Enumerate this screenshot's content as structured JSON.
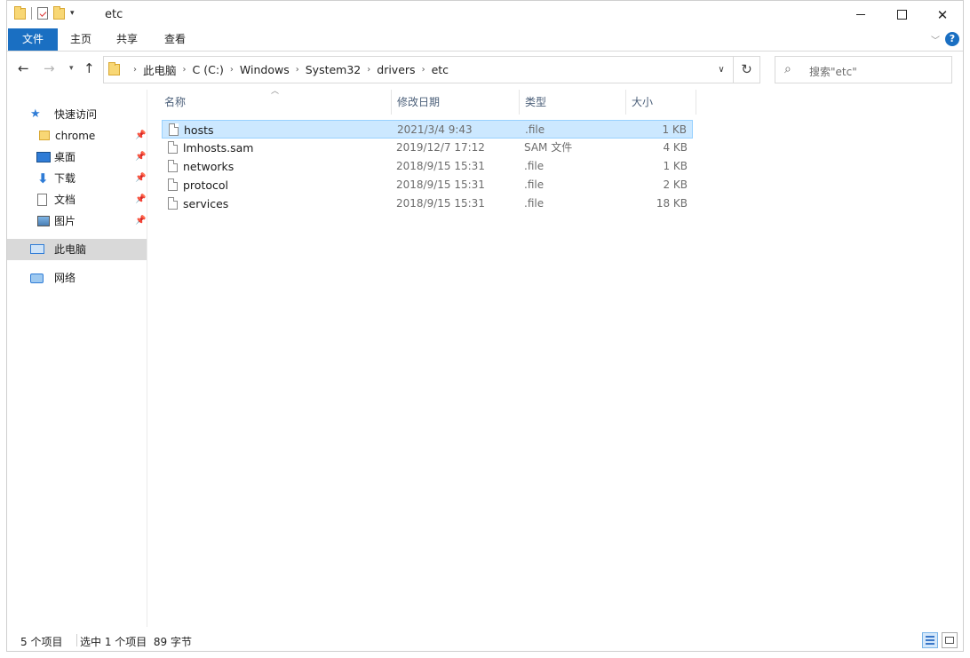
{
  "window": {
    "title": "etc",
    "qat_dropdown": "▾"
  },
  "ribbon": {
    "tabs": [
      {
        "label": "文件"
      },
      {
        "label": "主页"
      },
      {
        "label": "共享"
      },
      {
        "label": "查看"
      }
    ],
    "help": "?"
  },
  "address": {
    "crumbs": [
      "此电脑",
      "C (C:)",
      "Windows",
      "System32",
      "drivers",
      "etc"
    ]
  },
  "search": {
    "placeholder": "搜索\"etc\""
  },
  "nav_pane": {
    "quick_access": "快速访问",
    "items": [
      {
        "label": "chrome",
        "icon": "folder-icon",
        "pinned": true
      },
      {
        "label": "桌面",
        "icon": "desktop-icon",
        "pinned": true
      },
      {
        "label": "下载",
        "icon": "download-icon",
        "pinned": true
      },
      {
        "label": "文档",
        "icon": "document-icon",
        "pinned": true
      },
      {
        "label": "图片",
        "icon": "pictures-icon",
        "pinned": true
      }
    ],
    "this_pc": "此电脑",
    "network": "网络"
  },
  "file_list": {
    "columns": [
      "名称",
      "修改日期",
      "类型",
      "大小"
    ],
    "rows": [
      {
        "name": "hosts",
        "date": "2021/3/4 9:43",
        "type": ".file",
        "size": "1 KB",
        "selected": true
      },
      {
        "name": "lmhosts.sam",
        "date": "2019/12/7 17:12",
        "type": "SAM 文件",
        "size": "4 KB",
        "selected": false
      },
      {
        "name": "networks",
        "date": "2018/9/15 15:31",
        "type": ".file",
        "size": "1 KB",
        "selected": false
      },
      {
        "name": "protocol",
        "date": "2018/9/15 15:31",
        "type": ".file",
        "size": "2 KB",
        "selected": false
      },
      {
        "name": "services",
        "date": "2018/9/15 15:31",
        "type": ".file",
        "size": "18 KB",
        "selected": false
      }
    ]
  },
  "status": {
    "item_count": "5 个项目",
    "selection": "选中 1 个项目  89 字节"
  },
  "colors": {
    "accent": "#1a6fc2",
    "selection_bg": "#cce8ff",
    "selection_border": "#99d1ff"
  }
}
